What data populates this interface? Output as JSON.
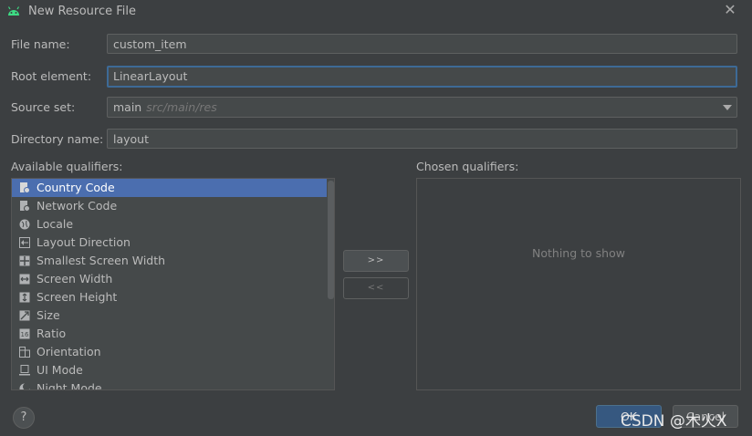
{
  "window": {
    "title": "New Resource File",
    "app_icon": "android-icon",
    "close_icon": "close-icon"
  },
  "form": {
    "file_name_label": "File name:",
    "file_name_value": "custom_item",
    "root_element_label": "Root element:",
    "root_element_value": "LinearLayout",
    "source_set_label": "Source set:",
    "source_set_value": "main",
    "source_set_path": "src/main/res",
    "directory_name_label": "Directory name:",
    "directory_name_value": "layout"
  },
  "qualifiers": {
    "available_label": "Available qualifiers:",
    "chosen_label": "Chosen qualifiers:",
    "items": [
      {
        "label": "Country Code",
        "icon": "country-code-icon",
        "selected": true
      },
      {
        "label": "Network Code",
        "icon": "network-code-icon"
      },
      {
        "label": "Locale",
        "icon": "globe-icon"
      },
      {
        "label": "Layout Direction",
        "icon": "layout-direction-icon"
      },
      {
        "label": "Smallest Screen Width",
        "icon": "smallest-width-icon"
      },
      {
        "label": "Screen Width",
        "icon": "screen-width-icon"
      },
      {
        "label": "Screen Height",
        "icon": "screen-height-icon"
      },
      {
        "label": "Size",
        "icon": "size-icon"
      },
      {
        "label": "Ratio",
        "icon": "ratio-icon"
      },
      {
        "label": "Orientation",
        "icon": "orientation-icon"
      },
      {
        "label": "UI Mode",
        "icon": "ui-mode-icon"
      },
      {
        "label": "Night Mode",
        "icon": "night-mode-icon"
      }
    ],
    "add_button": ">>",
    "remove_button": "<<",
    "empty_text": "Nothing to show"
  },
  "footer": {
    "help_label": "?",
    "ok_label": "OK",
    "cancel_label": "Cancel",
    "watermark": "CSDN @木火X"
  },
  "colors": {
    "accent": "#4b6eaf",
    "focus_border": "#3d6a96",
    "background": "#3c3f41"
  }
}
